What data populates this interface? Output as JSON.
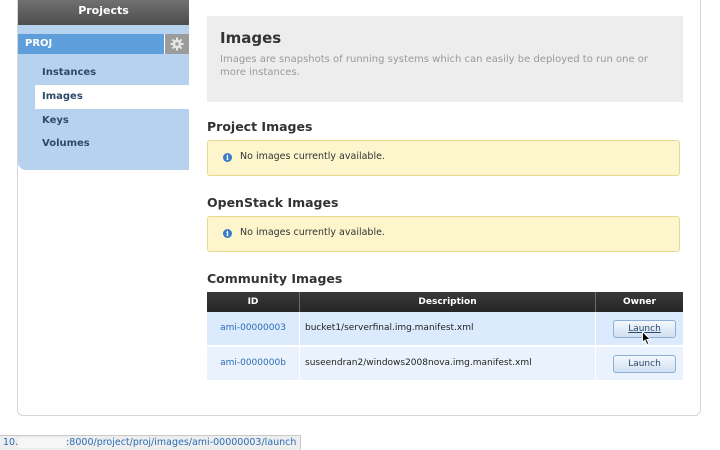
{
  "sidebar": {
    "header": "Projects",
    "project": "PROJ",
    "items": [
      {
        "label": "Instances"
      },
      {
        "label": "Images"
      },
      {
        "label": "Keys"
      },
      {
        "label": "Volumes"
      }
    ]
  },
  "intro": {
    "title": "Images",
    "description": "Images are snapshots of running systems which can easily be deployed to run one or more instances."
  },
  "sections": {
    "project_images": {
      "title": "Project Images",
      "message": "No images currently available."
    },
    "openstack_images": {
      "title": "OpenStack Images",
      "message": "No images currently available."
    },
    "community_images": {
      "title": "Community Images",
      "columns": [
        "ID",
        "Description",
        "Owner"
      ],
      "rows": [
        {
          "id": "ami-00000003",
          "description": "bucket1/serverfinal.img.manifest.xml",
          "action": "Launch"
        },
        {
          "id": "ami-0000000b",
          "description": "suseendran2/windows2008nova.img.manifest.xml",
          "action": "Launch"
        }
      ]
    }
  },
  "statusbar": {
    "prefix": "10.",
    "url": ":8000/project/proj/images/ami-00000003/launch"
  },
  "icons": {
    "settings": "gear-icon",
    "info": "info-icon",
    "cursor": "mouse-pointer-icon"
  },
  "colors": {
    "sidebar": "#b7d2ee",
    "project_bar": "#5e9fdb",
    "alert_bg": "#fdf6cc",
    "table_header": "#2b2b2b",
    "link": "#2a6db5"
  }
}
